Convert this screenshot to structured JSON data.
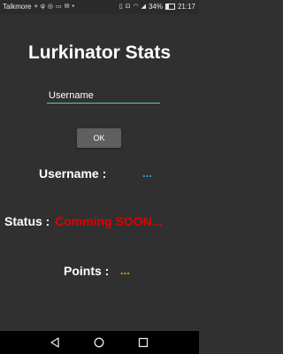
{
  "status_bar": {
    "carrier": "Talkmore",
    "battery": "34%",
    "time": "21:17"
  },
  "app": {
    "title": "Lurkinator Stats"
  },
  "form": {
    "username_placeholder": "Username",
    "ok_label": "OK"
  },
  "stats": {
    "username_label": "Username :",
    "username_value": "...",
    "status_label": "Status :",
    "status_value": "Comming SOON...",
    "points_label": "Points :",
    "points_value": "..."
  },
  "colors": {
    "background": "#303030",
    "accent": "#4fd0b8",
    "username_value": "#29a3e0",
    "status_value": "#e00000",
    "points_value": "#f0a020"
  },
  "icons": [
    "vibrate-icon",
    "usb-icon",
    "instagram-icon",
    "messenger-icon",
    "mail-icon",
    "signal-icon",
    "wifi-icon",
    "battery-icon",
    "back-icon",
    "home-icon",
    "recents-icon"
  ]
}
